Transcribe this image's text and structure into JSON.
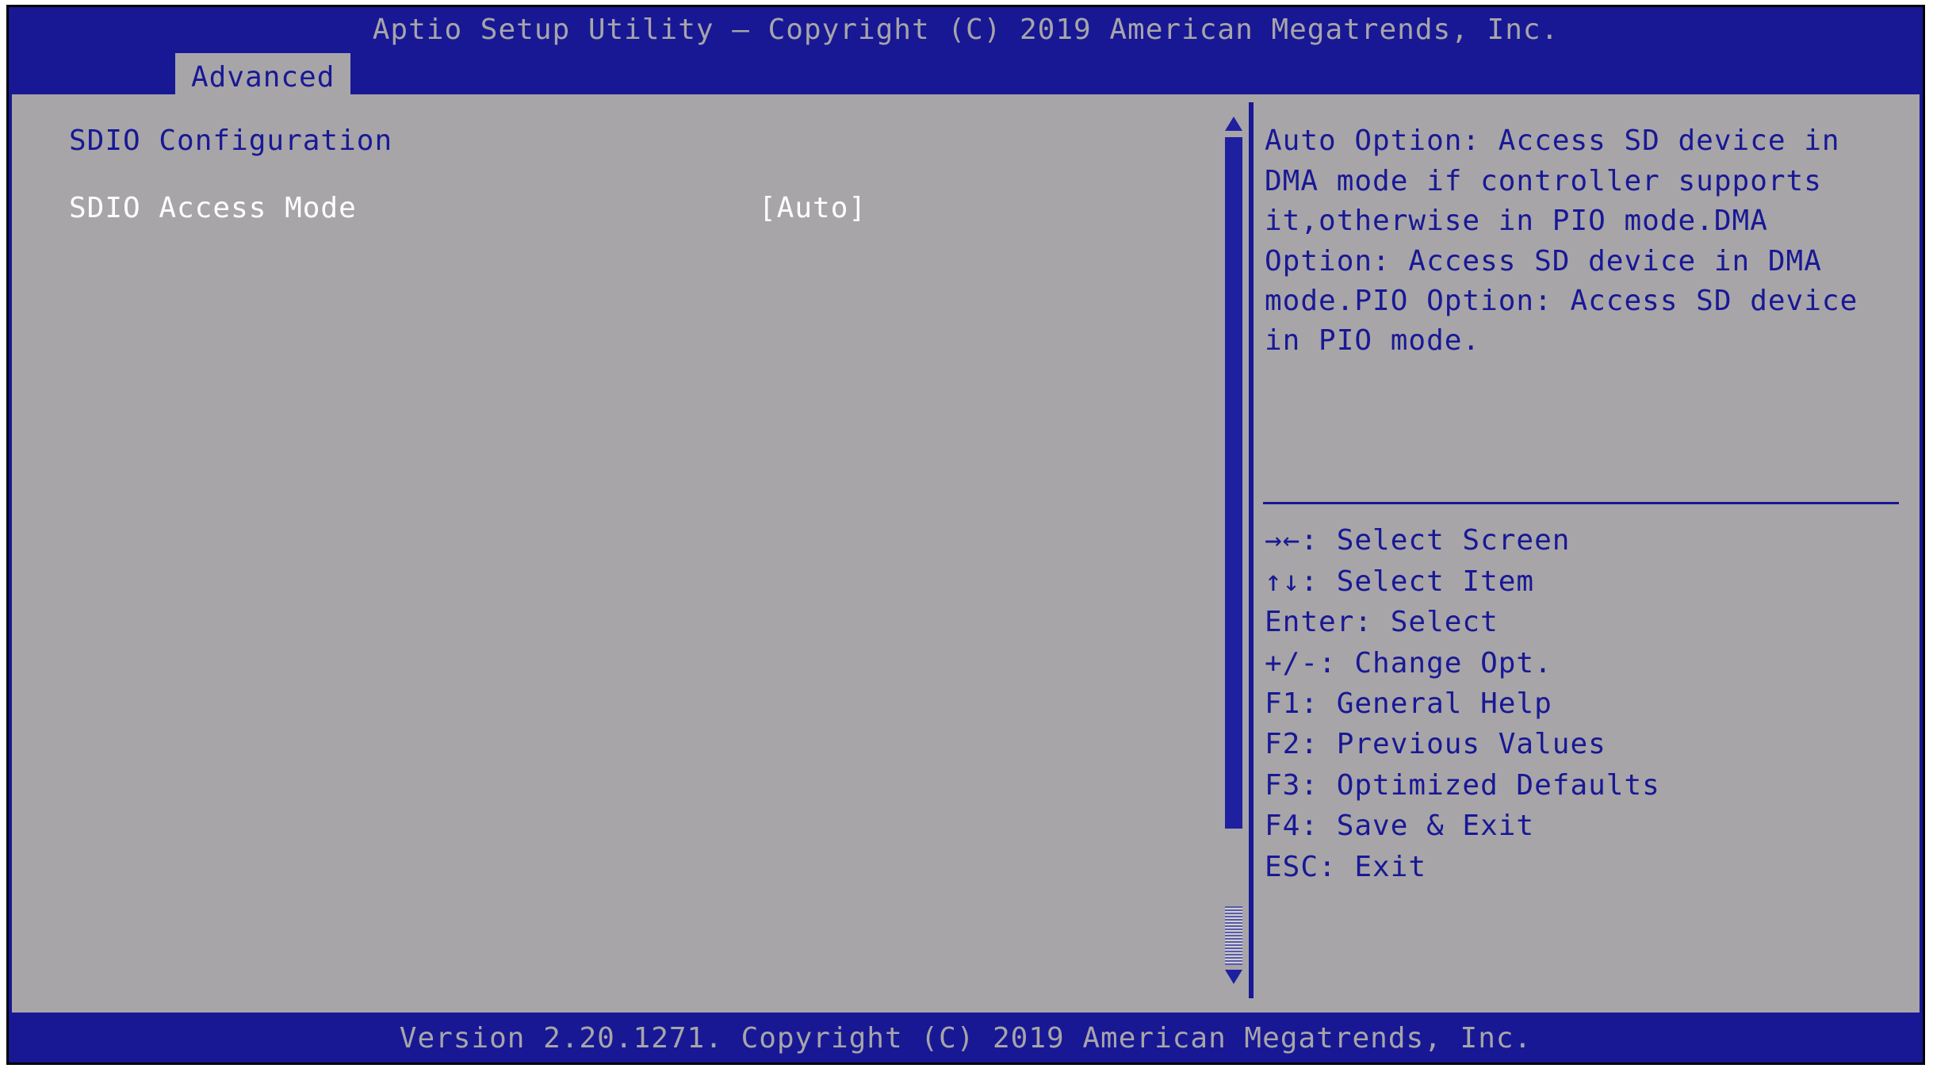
{
  "title": "Aptio Setup Utility – Copyright (C) 2019 American Megatrends, Inc.",
  "footer": "Version 2.20.1271. Copyright (C) 2019 American Megatrends, Inc.",
  "active_tab": "Advanced",
  "main": {
    "section_title": "SDIO Configuration",
    "setting_label": "SDIO Access Mode",
    "setting_value": "[Auto]"
  },
  "help": {
    "text": "Auto Option: Access SD device in DMA mode if controller supports it,otherwise in PIO mode.DMA Option: Access SD device in DMA mode.PIO Option: Access SD device in PIO mode."
  },
  "keys": {
    "select_screen": "→←: Select Screen",
    "select_item": "↑↓: Select Item",
    "select": "Enter: Select",
    "change_opt": "+/-: Change Opt.",
    "help": "F1: General Help",
    "prev": "F2: Previous Values",
    "defaults": "F3: Optimized Defaults",
    "save_exit": "F4: Save & Exit",
    "exit": "ESC: Exit"
  }
}
